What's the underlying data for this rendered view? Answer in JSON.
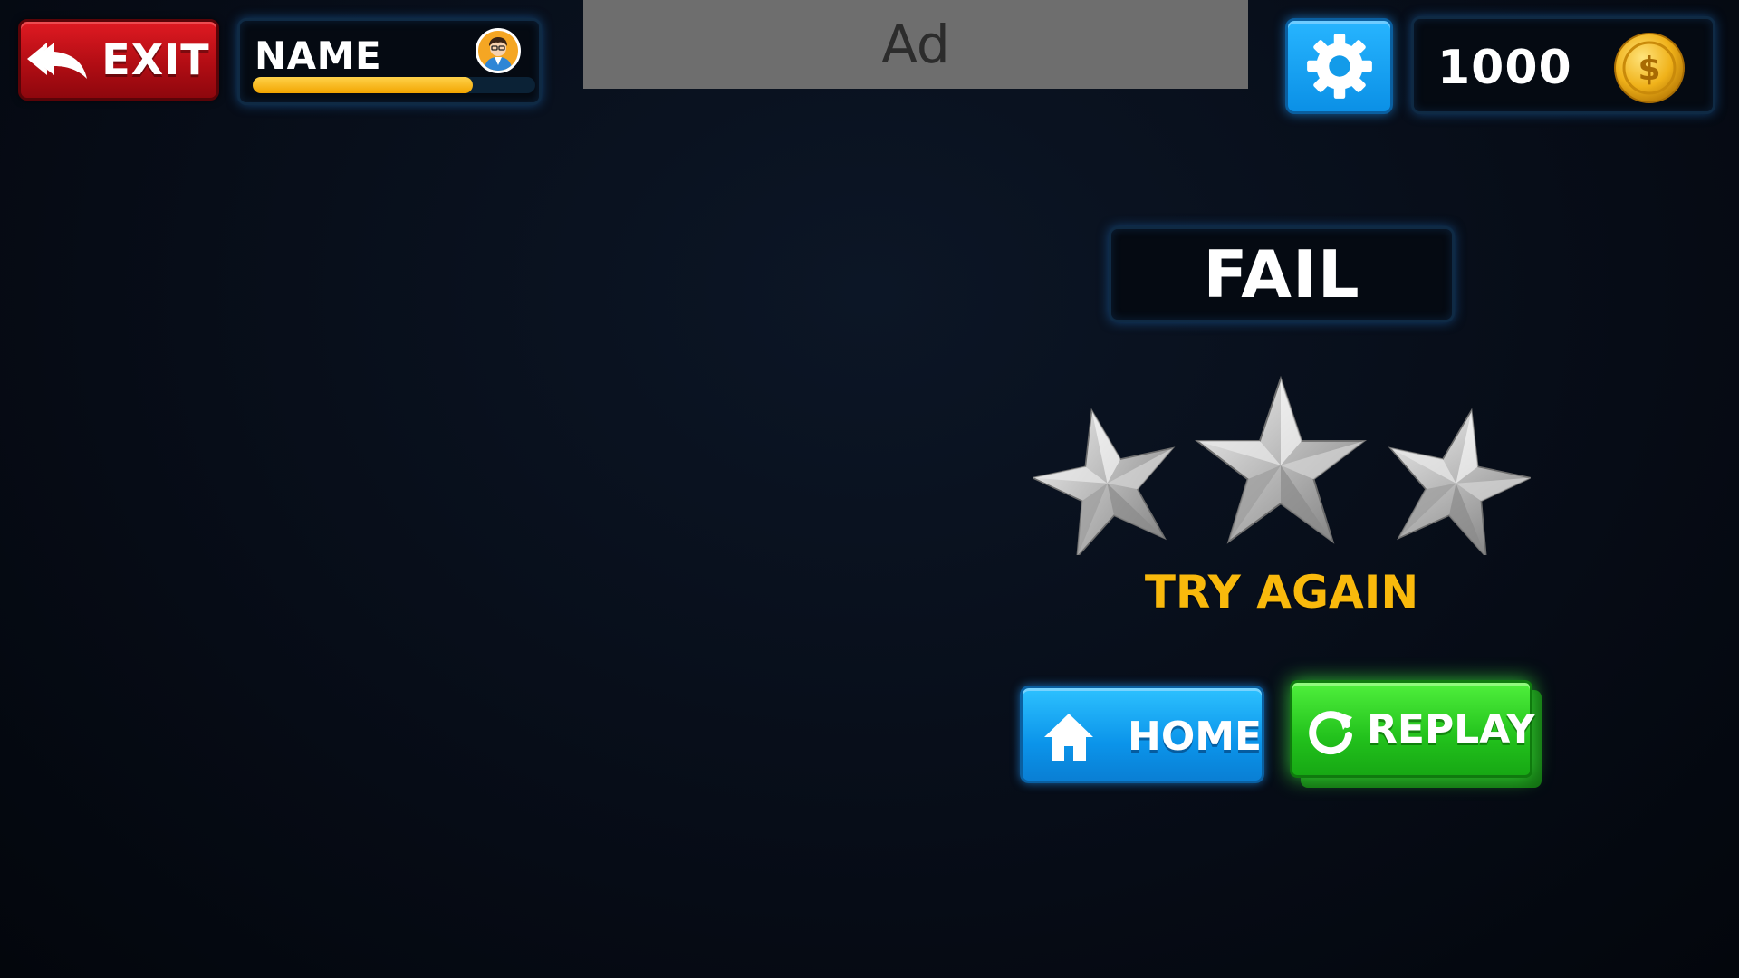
{
  "header": {
    "exit_label": "EXIT",
    "player_name": "NAME",
    "xp_progress": 0.78,
    "ad_label": "Ad",
    "coins": "1000"
  },
  "result": {
    "title": "FAIL",
    "stars_earned": 0,
    "stars_total": 3,
    "message": "TRY AGAIN"
  },
  "actions": {
    "home_label": "HOME",
    "replay_label": "REPLAY"
  },
  "icons": {
    "exit": "double-back-arrow-icon",
    "avatar": "player-avatar-icon",
    "settings": "gear-icon",
    "coin": "dollar-coin-icon",
    "home": "house-icon",
    "replay": "refresh-icon",
    "star": "silver-star-icon"
  },
  "colors": {
    "exit_red": "#c8121b",
    "settings_blue": "#16a3f5",
    "home_blue": "#1aa8f7",
    "replay_green": "#2fd625",
    "message_yellow": "#f9b90c",
    "xp_yellow": "#f2a400",
    "ad_gray": "#6e6e6e"
  }
}
